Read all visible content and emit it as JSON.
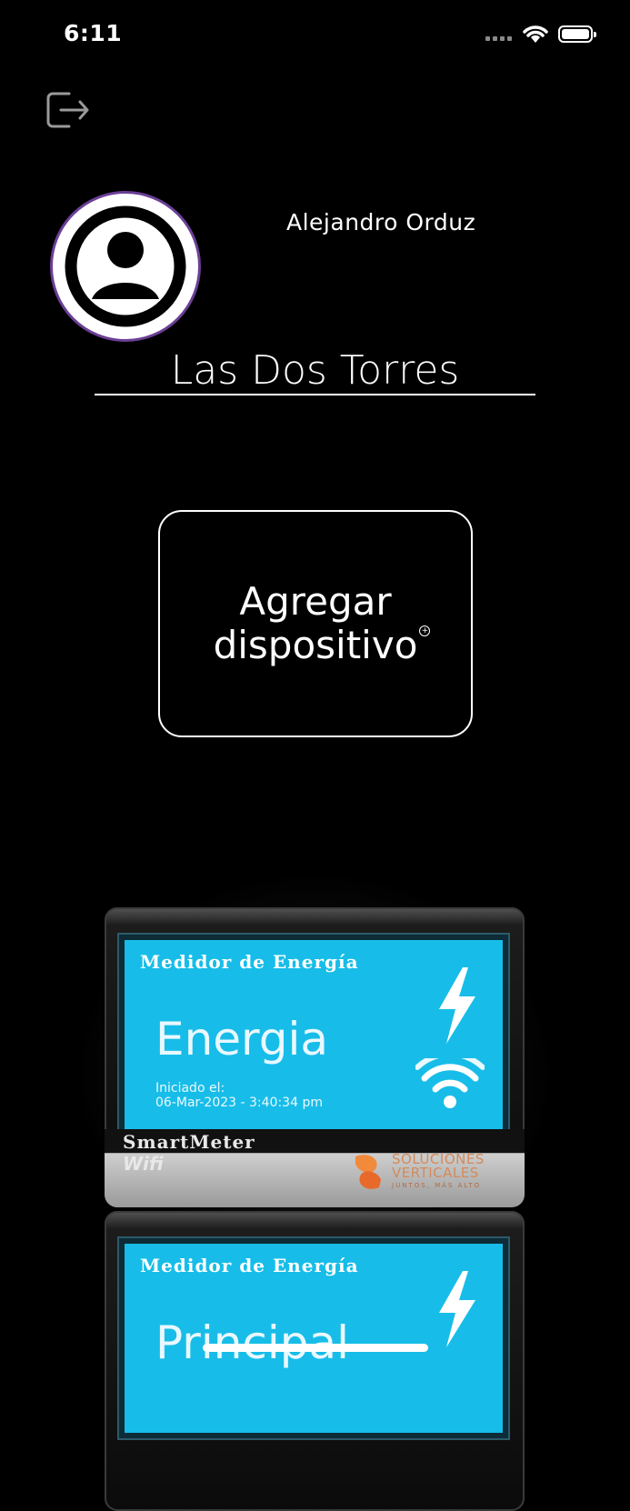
{
  "status_bar": {
    "time": "6:11"
  },
  "profile": {
    "name": "Alejandro Orduz"
  },
  "company": {
    "name": "Las Dos Torres"
  },
  "add_device": {
    "line1": "Agregar",
    "line2": "dispositivo"
  },
  "devices": [
    {
      "header": "Medidor de Energía",
      "name": "Energia",
      "started_label": "Iniciado el:",
      "started_value": "06-Mar-2023 - 3:40:34 pm",
      "brand_line1": "SmartMeter",
      "brand_line2": "Wifi",
      "maker_line1": "SOLUCIONES",
      "maker_line2": "VERTICALES",
      "maker_slogan": "JUNTOS, MÁS ALTO"
    },
    {
      "header": "Medidor de Energía",
      "name": "Principal"
    }
  ],
  "colors": {
    "screen": "#17bde8",
    "avatar_ring": "#6b3f96"
  },
  "icons": [
    "logout-icon",
    "user-avatar-icon",
    "add-circle-icon",
    "bolt-icon",
    "wifi-icon"
  ]
}
